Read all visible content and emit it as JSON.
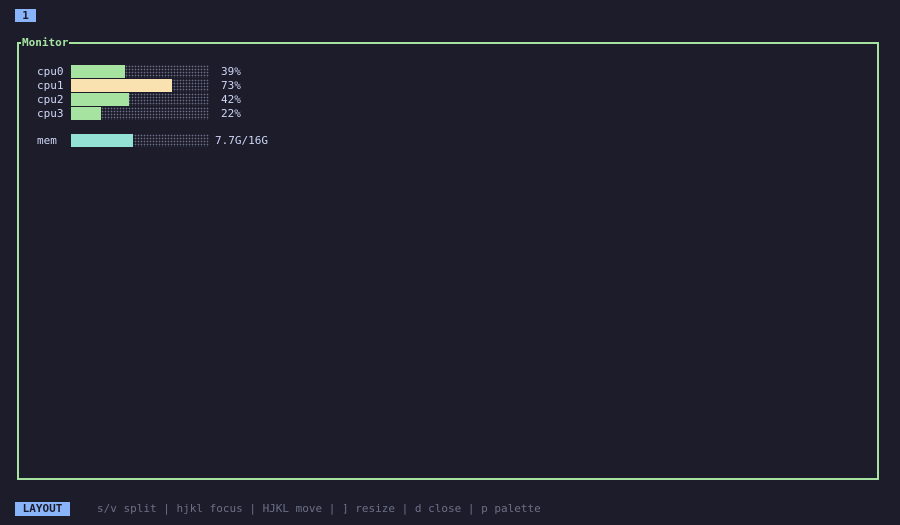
{
  "workspace": {
    "tab_label": "1"
  },
  "pane": {
    "title": "Monitor",
    "cpus": [
      {
        "label": "cpu0",
        "value_text": "39%",
        "fraction": 0.39,
        "color": "#a6e3a1"
      },
      {
        "label": "cpu1",
        "value_text": "73%",
        "fraction": 0.73,
        "color": "#f9e2af"
      },
      {
        "label": "cpu2",
        "value_text": "42%",
        "fraction": 0.42,
        "color": "#a6e3a1"
      },
      {
        "label": "cpu3",
        "value_text": "22%",
        "fraction": 0.22,
        "color": "#a6e3a1"
      }
    ],
    "mem": {
      "label": "mem",
      "value_text": "7.7G/16G",
      "fraction": 0.45,
      "color": "#94e2d5"
    }
  },
  "status_bar": {
    "mode": "LAYOUT",
    "hints": "s/v split | hjkl focus | HJKL move | ] resize | d close | p palette"
  },
  "colors": {
    "background": "#1c1c2b",
    "pane_border": "#a6e3a1",
    "badge": "#89b4fa",
    "hint_text": "#6c7086"
  }
}
